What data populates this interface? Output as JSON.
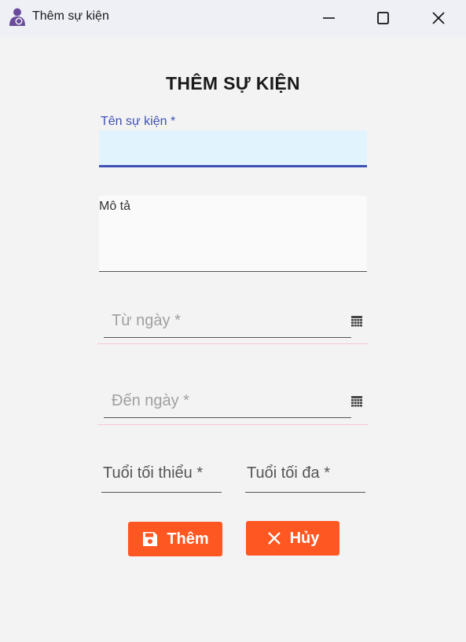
{
  "window": {
    "title": "Thêm sự kiện",
    "app_icon": "mother-child-icon",
    "controls": [
      "minimize-icon",
      "maximize-icon",
      "close-icon"
    ]
  },
  "form": {
    "heading": "THÊM SỰ KIỆN",
    "name_label": "Tên sự kiện *",
    "name_value": "",
    "description_label": "Mô tả",
    "description_value": "",
    "from_date_placeholder": "Từ ngày *",
    "to_date_placeholder": "Đến ngày *",
    "min_age_placeholder": "Tuổi tối thiểu *",
    "max_age_placeholder": "Tuổi tối đa *"
  },
  "buttons": {
    "add_label": "Thêm",
    "add_icon": "save-icon",
    "cancel_label": "Hủy",
    "cancel_icon": "close-icon"
  },
  "colors": {
    "accent": "#3f51b5",
    "button": "#ff5722",
    "input_focus_bg": "#e1f4fd",
    "error_line": "#f7c6d3"
  }
}
